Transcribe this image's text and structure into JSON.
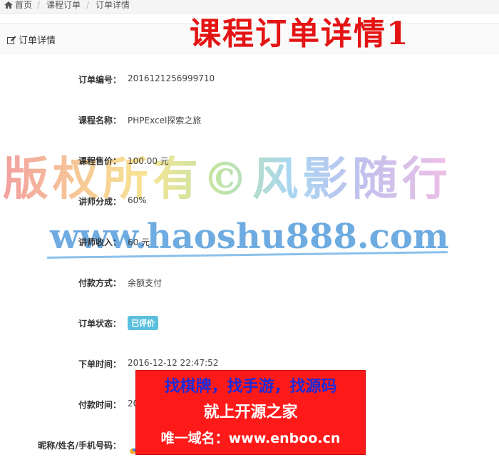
{
  "breadcrumb": {
    "items": [
      "首页",
      "课程订单",
      "订单详情"
    ]
  },
  "panel": {
    "title": "订单详情"
  },
  "overlay": {
    "title": "课程订单详情1"
  },
  "details": [
    {
      "label": "订单编号：",
      "value": "2016121256999710"
    },
    {
      "label": "课程名称：",
      "value": "PHPExcel探索之旅"
    },
    {
      "label": "课程售价：",
      "value": "100.00 元"
    },
    {
      "label": "讲师分成：",
      "value": "60%"
    },
    {
      "label": "讲师收入：",
      "value": "60 元"
    },
    {
      "label": "付款方式：",
      "value": "余额支付"
    },
    {
      "label": "订单状态：",
      "value": "已评价"
    },
    {
      "label": "下单时间：",
      "value": "2016-12-12 22:47:52"
    },
    {
      "label": "付款时间：",
      "value": "20"
    },
    {
      "label": "昵称/姓名/手机号码：",
      "value": ""
    }
  ],
  "watermark": {
    "line1": "版权所有©风影随行",
    "line2": "www.haoshu888.com"
  },
  "ad": {
    "line1": "找棋牌，找手游，找源码",
    "line2": "就上开源之家",
    "line3": "唯一域名：www.enboo.cn"
  },
  "colors": {
    "accent_red": "#e41414",
    "badge": "#5bc0de",
    "ad_background": "#ff1a1a",
    "ad_blue_text": "#1a2bd8"
  }
}
